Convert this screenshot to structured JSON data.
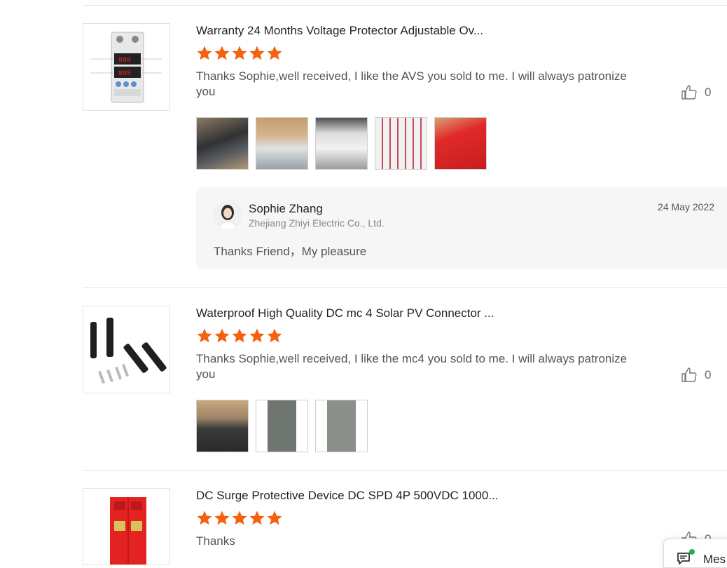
{
  "colors": {
    "star": "#f5620f",
    "reply_bg": "#f6f6f6"
  },
  "reviews": [
    {
      "product_title": "Warranty 24 Months Voltage Protector Adjustable Ov...",
      "rating": 5,
      "text": "Thanks Sophie,well received, I like the AVS you sold to me. I will always patronize you",
      "likes": "0",
      "photo_count": 5,
      "reply": {
        "name": "Sophie Zhang",
        "company": "Zhejiang Zhiyi Electric Co., Ltd.",
        "date": "24 May 2022",
        "text": "Thanks Friend，My pleasure"
      }
    },
    {
      "product_title": "Waterproof High Quality DC mc 4 Solar PV Connector ...",
      "rating": 5,
      "text": "Thanks Sophie,well received, I like the mc4 you sold to me. I will always patronize you",
      "likes": "0",
      "photo_count": 3
    },
    {
      "product_title": "DC Surge Protective Device DC SPD 4P 500VDC 1000...",
      "rating": 5,
      "text": "Thanks",
      "likes": "0"
    }
  ],
  "message_widget": {
    "label": "Mes",
    "icon": "message-icon"
  }
}
